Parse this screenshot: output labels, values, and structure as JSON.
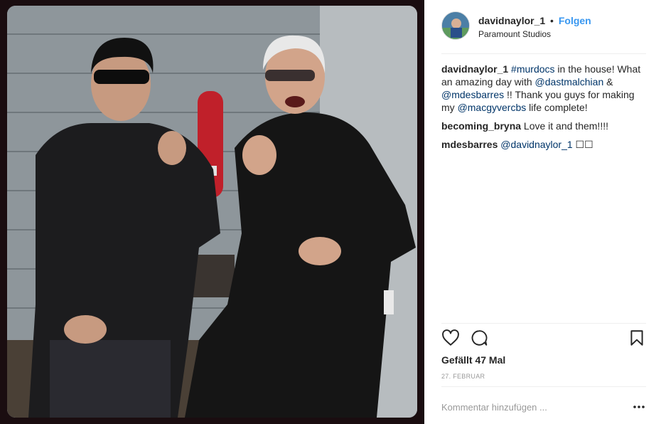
{
  "post": {
    "username": "davidnaylor_1",
    "separator": "•",
    "follow_label": "Folgen",
    "location": "Paramount Studios",
    "photo_description_icon": "photo"
  },
  "comments": [
    {
      "user": "davidnaylor_1",
      "parts": [
        {
          "type": "hashtag",
          "text": "#murdocs"
        },
        {
          "type": "text",
          "text": " in the house! What an amazing day with "
        },
        {
          "type": "mention",
          "text": "@dastmalchian"
        },
        {
          "type": "text",
          "text": " & "
        },
        {
          "type": "mention",
          "text": "@mdesbarres"
        },
        {
          "type": "text",
          "text": " !! Thank you guys for making my "
        },
        {
          "type": "mention",
          "text": "@macgyvercbs"
        },
        {
          "type": "text",
          "text": " life complete!"
        }
      ]
    },
    {
      "user": "becoming_bryna",
      "parts": [
        {
          "type": "text",
          "text": "Love it and them!!!!"
        }
      ]
    },
    {
      "user": "mdesbarres",
      "parts": [
        {
          "type": "mention",
          "text": "@davidnaylor_1"
        },
        {
          "type": "text",
          "text": " ☐☐"
        }
      ]
    }
  ],
  "actions": {
    "like_icon": "heart-icon",
    "comment_icon": "comment-icon",
    "save_icon": "bookmark-icon"
  },
  "likes_text": "Gefällt 47 Mal",
  "date_text": "27. FEBRUAR",
  "comment_input": {
    "placeholder": "Kommentar hinzufügen ..."
  },
  "more_label": "•••"
}
